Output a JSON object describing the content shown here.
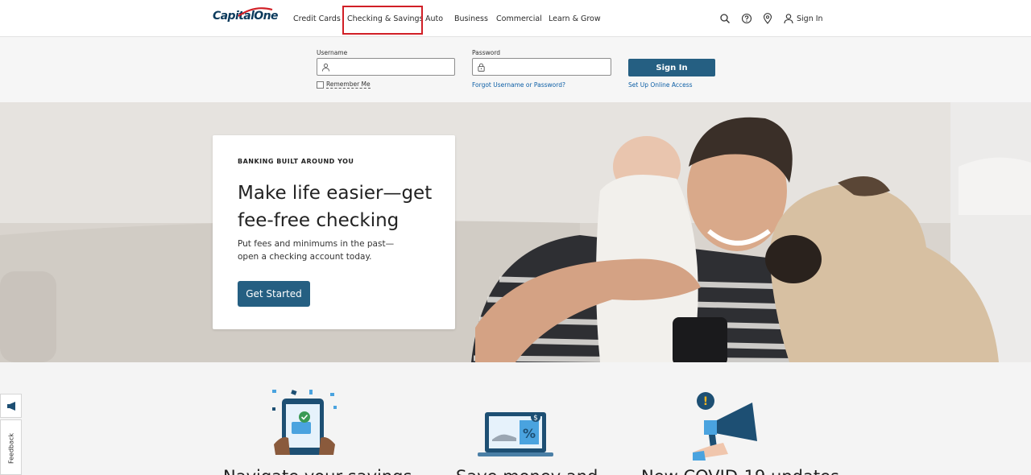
{
  "brand": {
    "logo_text": "CapitalOne",
    "primary_color": "#255f82",
    "highlight_color": "#d11f26"
  },
  "nav": {
    "items": [
      {
        "label": "Credit Cards"
      },
      {
        "label": "Checking & Savings",
        "highlighted": true
      },
      {
        "label": "Auto"
      },
      {
        "label": "Business"
      },
      {
        "label": "Commercial"
      },
      {
        "label": "Learn & Grow"
      }
    ],
    "icons": [
      "search-icon",
      "help-icon",
      "location-pin-icon",
      "user-icon"
    ],
    "sign_in_label": "Sign In"
  },
  "login": {
    "username_label": "Username",
    "password_label": "Password",
    "remember_label": "Remember Me",
    "forgot_label": "Forgot Username or Password?",
    "sign_in_button": "Sign In",
    "setup_label": "Set Up Online Access"
  },
  "hero": {
    "eyebrow": "BANKING BUILT AROUND YOU",
    "headline": "Make life easier—get fee-free checking",
    "subcopy": "Put fees and minimums in the past—open a checking account today.",
    "cta": "Get Started"
  },
  "features": [
    {
      "icon": "phone-card-icon",
      "title": "Navigate your savings"
    },
    {
      "icon": "laptop-discount-icon",
      "title": "Save money and"
    },
    {
      "icon": "megaphone-icon",
      "title": "New COVID-19 updates"
    }
  ],
  "feedback": {
    "label": "Feedback",
    "icon": "megaphone-icon"
  }
}
